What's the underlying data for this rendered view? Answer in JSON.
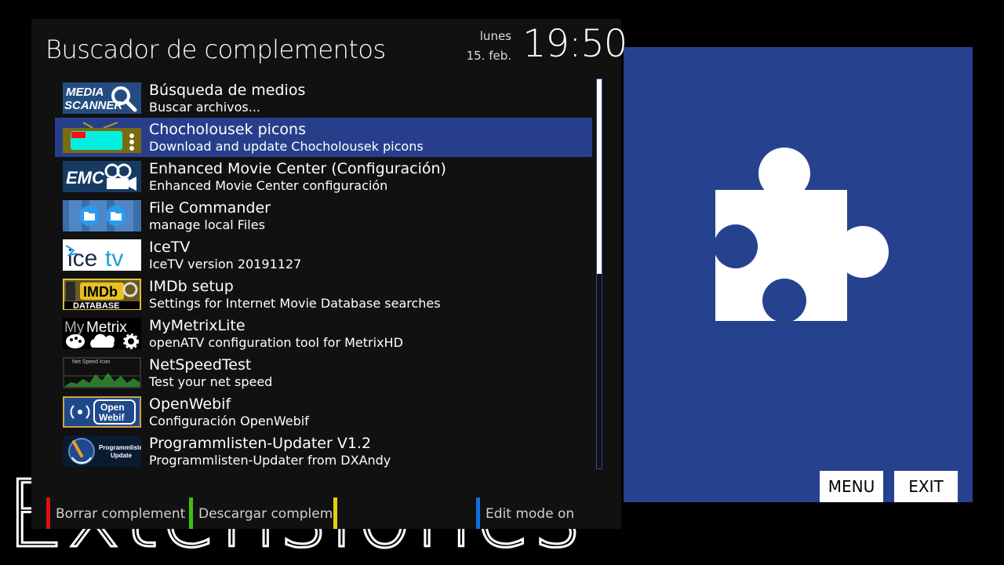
{
  "screen": {
    "title": "Buscador de complementos",
    "watermark": "Extensiones",
    "date_day": "lunes",
    "date_date": "15. feb.",
    "clock": "19:50"
  },
  "colors": {
    "selection": "#273f8b",
    "preview_bg": "#26418e",
    "red_key": "#e01010",
    "green_key": "#40c010",
    "yellow_key": "#e0d010",
    "blue_key": "#1070e0"
  },
  "plugins": [
    {
      "title": "Búsqueda de medios",
      "description": "Buscar archivos...",
      "icon": "media-scanner-icon",
      "selected": false
    },
    {
      "title": "Chocholousek picons",
      "description": "Download and update Chocholousek picons",
      "icon": "retro-tv-icon",
      "selected": true
    },
    {
      "title": "Enhanced Movie Center (Configuración)",
      "description": "Enhanced Movie Center configuración",
      "icon": "emc-camera-icon",
      "selected": false
    },
    {
      "title": "File Commander",
      "description": "manage local Files",
      "icon": "folder-icon",
      "selected": false
    },
    {
      "title": "IceTV",
      "description": "IceTV version 20191127",
      "icon": "icetv-logo-icon",
      "selected": false
    },
    {
      "title": "IMDb setup",
      "description": "Settings for Internet Movie Database searches",
      "icon": "imdb-database-icon",
      "selected": false
    },
    {
      "title": "MyMetrixLite",
      "description": "openATV configuration tool for MetrixHD",
      "icon": "mymetrix-icon",
      "selected": false
    },
    {
      "title": "NetSpeedTest",
      "description": "Test your net speed",
      "icon": "netspeed-graph-icon",
      "selected": false
    },
    {
      "title": "OpenWebif",
      "description": "Configuración OpenWebif",
      "icon": "openwebif-icon",
      "selected": false
    },
    {
      "title": "Programmlisten-Updater V1.2",
      "description": "Programmlisten-Updater from DXAndy",
      "icon": "programmlisten-update-icon",
      "selected": false
    }
  ],
  "thumb_text": {
    "media_1": "MEDIA",
    "media_2": "SCANNER",
    "emc": "EMC",
    "ice": "ice",
    "tv": "tv",
    "imdb": "IMDb",
    "database": "DATABASE",
    "my": "My",
    "metrix": "Metrix",
    "netspeed": "Net Speed Icon",
    "open": "Open",
    "webif": "Webif",
    "programm": "Programmlisten",
    "update": "Update"
  },
  "scrollbar": {
    "position_fraction": 0.0,
    "visible_fraction": 0.5
  },
  "color_keys": {
    "red": "Borrar complementos",
    "green": "Descargar complementos",
    "yellow": "",
    "blue": "Edit mode on"
  },
  "preview": {
    "icon": "puzzle-piece-icon"
  },
  "hardware_buttons": {
    "menu": "MENU",
    "exit": "EXIT"
  }
}
